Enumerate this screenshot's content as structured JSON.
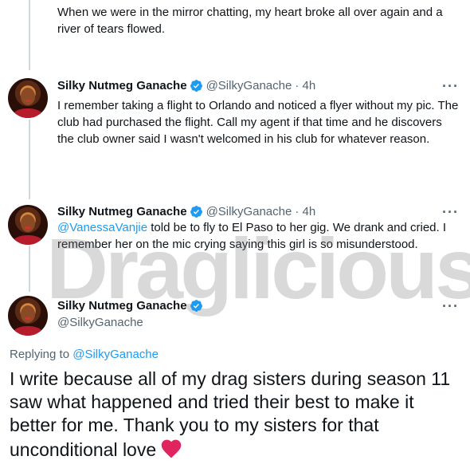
{
  "watermark": "Draglicious",
  "top_tweet": {
    "text": "When we were in the mirror chatting, my heart broke all over again and a river of tears flowed."
  },
  "tweets": [
    {
      "name": "Silky Nutmeg Ganache",
      "handle": "@SilkyGanache",
      "time": "· 4h",
      "more": "···",
      "text": "I remember taking a flight to Orlando and noticed a flyer without my pic. The club had purchased the flight. Call my agent if that time and he discovers  the club owner said I wasn't welcomed in his club for whatever reason."
    },
    {
      "name": "Silky Nutmeg Ganache",
      "handle": "@SilkyGanache",
      "time": "· 4h",
      "more": "···",
      "mention": "@VanessaVanjie",
      "text": " told be to fly to El Paso to her gig. We drank and cried. I remember her on the mic crying saying this girl is so misunderstood."
    }
  ],
  "main_tweet": {
    "name": "Silky Nutmeg Ganache",
    "handle": "@SilkyGanache",
    "more": "···",
    "replying_label": "Replying to ",
    "replying_to": "@SilkyGanache",
    "text": "I write because all of my drag sisters during season 11 saw what happened and tried their best to make it better for me. Thank you to my sisters for that unconditional love"
  },
  "colors": {
    "link": "#1d9bf0",
    "verified": "#1d9bf0",
    "heart": "#e0245e",
    "secondary_text": "#536471"
  }
}
